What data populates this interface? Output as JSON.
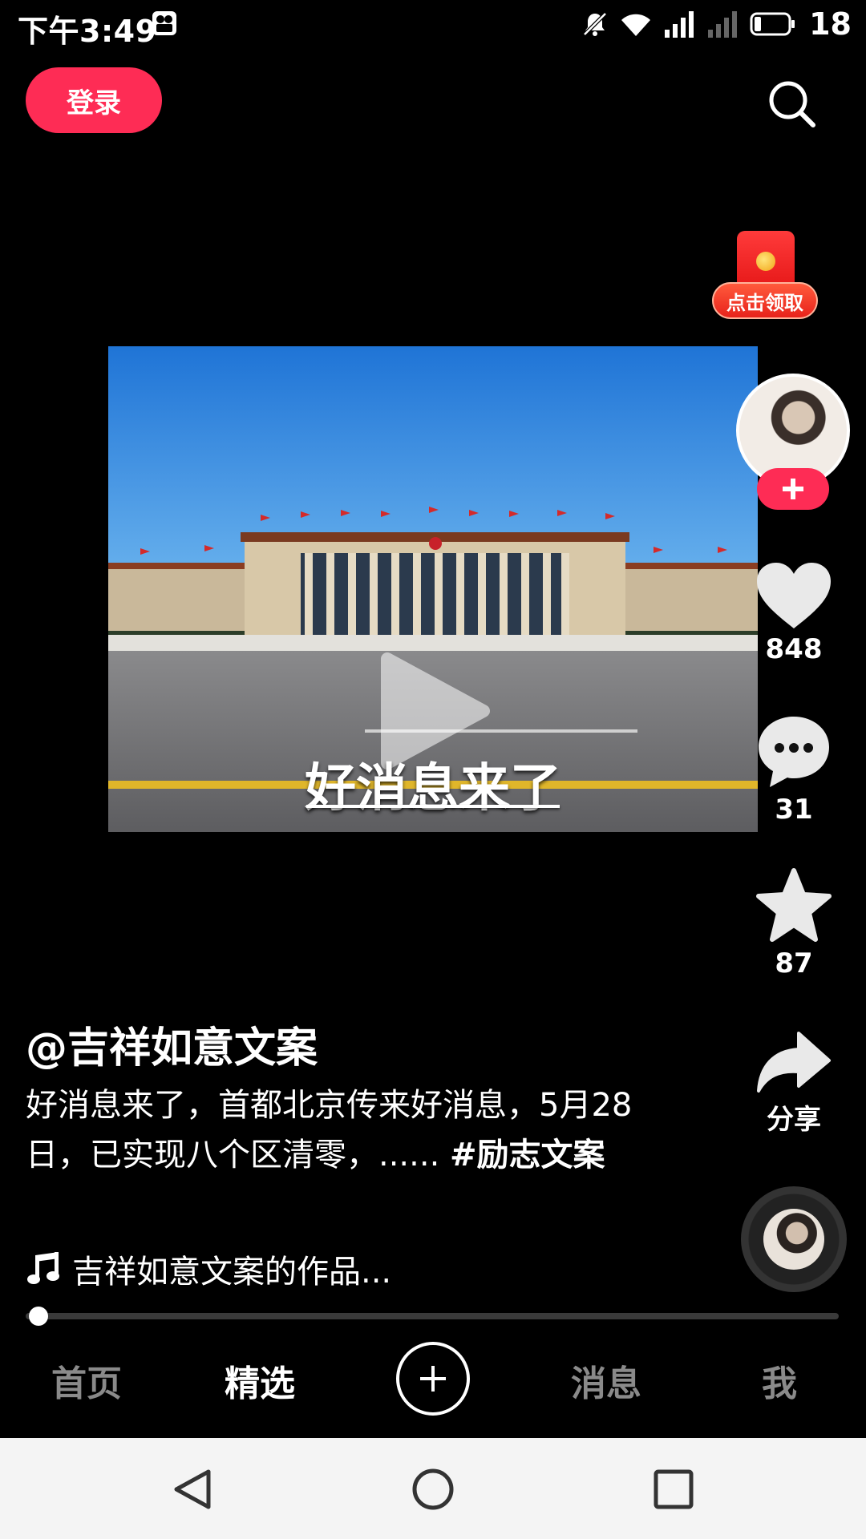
{
  "status_bar": {
    "time": "下午3:49",
    "battery": "18",
    "icons": [
      "camera-app-icon",
      "bell-muted-icon",
      "wifi-icon",
      "signal-icon",
      "signal-empty-icon",
      "battery-icon"
    ]
  },
  "top": {
    "login_label": "登录",
    "search_icon": "search-icon"
  },
  "red_packet": {
    "label": "点击领取"
  },
  "video": {
    "caption": "好消息来了"
  },
  "rail": {
    "likes": "848",
    "comments": "31",
    "favorites": "87",
    "share_label": "分享"
  },
  "post": {
    "author": "@吉祥如意文案",
    "description_text": "好消息来了，首都北京传来好消息，5月28日，已实现八个区清零，...... ",
    "hashtag": "#励志文案",
    "music": "吉祥如意文案的作品..."
  },
  "progress": {
    "fraction": 0.01
  },
  "tabs": [
    {
      "label": "首页",
      "active": false
    },
    {
      "label": "精选",
      "active": true
    },
    {
      "label": "消息",
      "active": false
    },
    {
      "label": "我",
      "active": false
    }
  ],
  "colors": {
    "accent": "#fe2c55",
    "background": "#000000",
    "inactive_tab": "#8a8a8a"
  }
}
